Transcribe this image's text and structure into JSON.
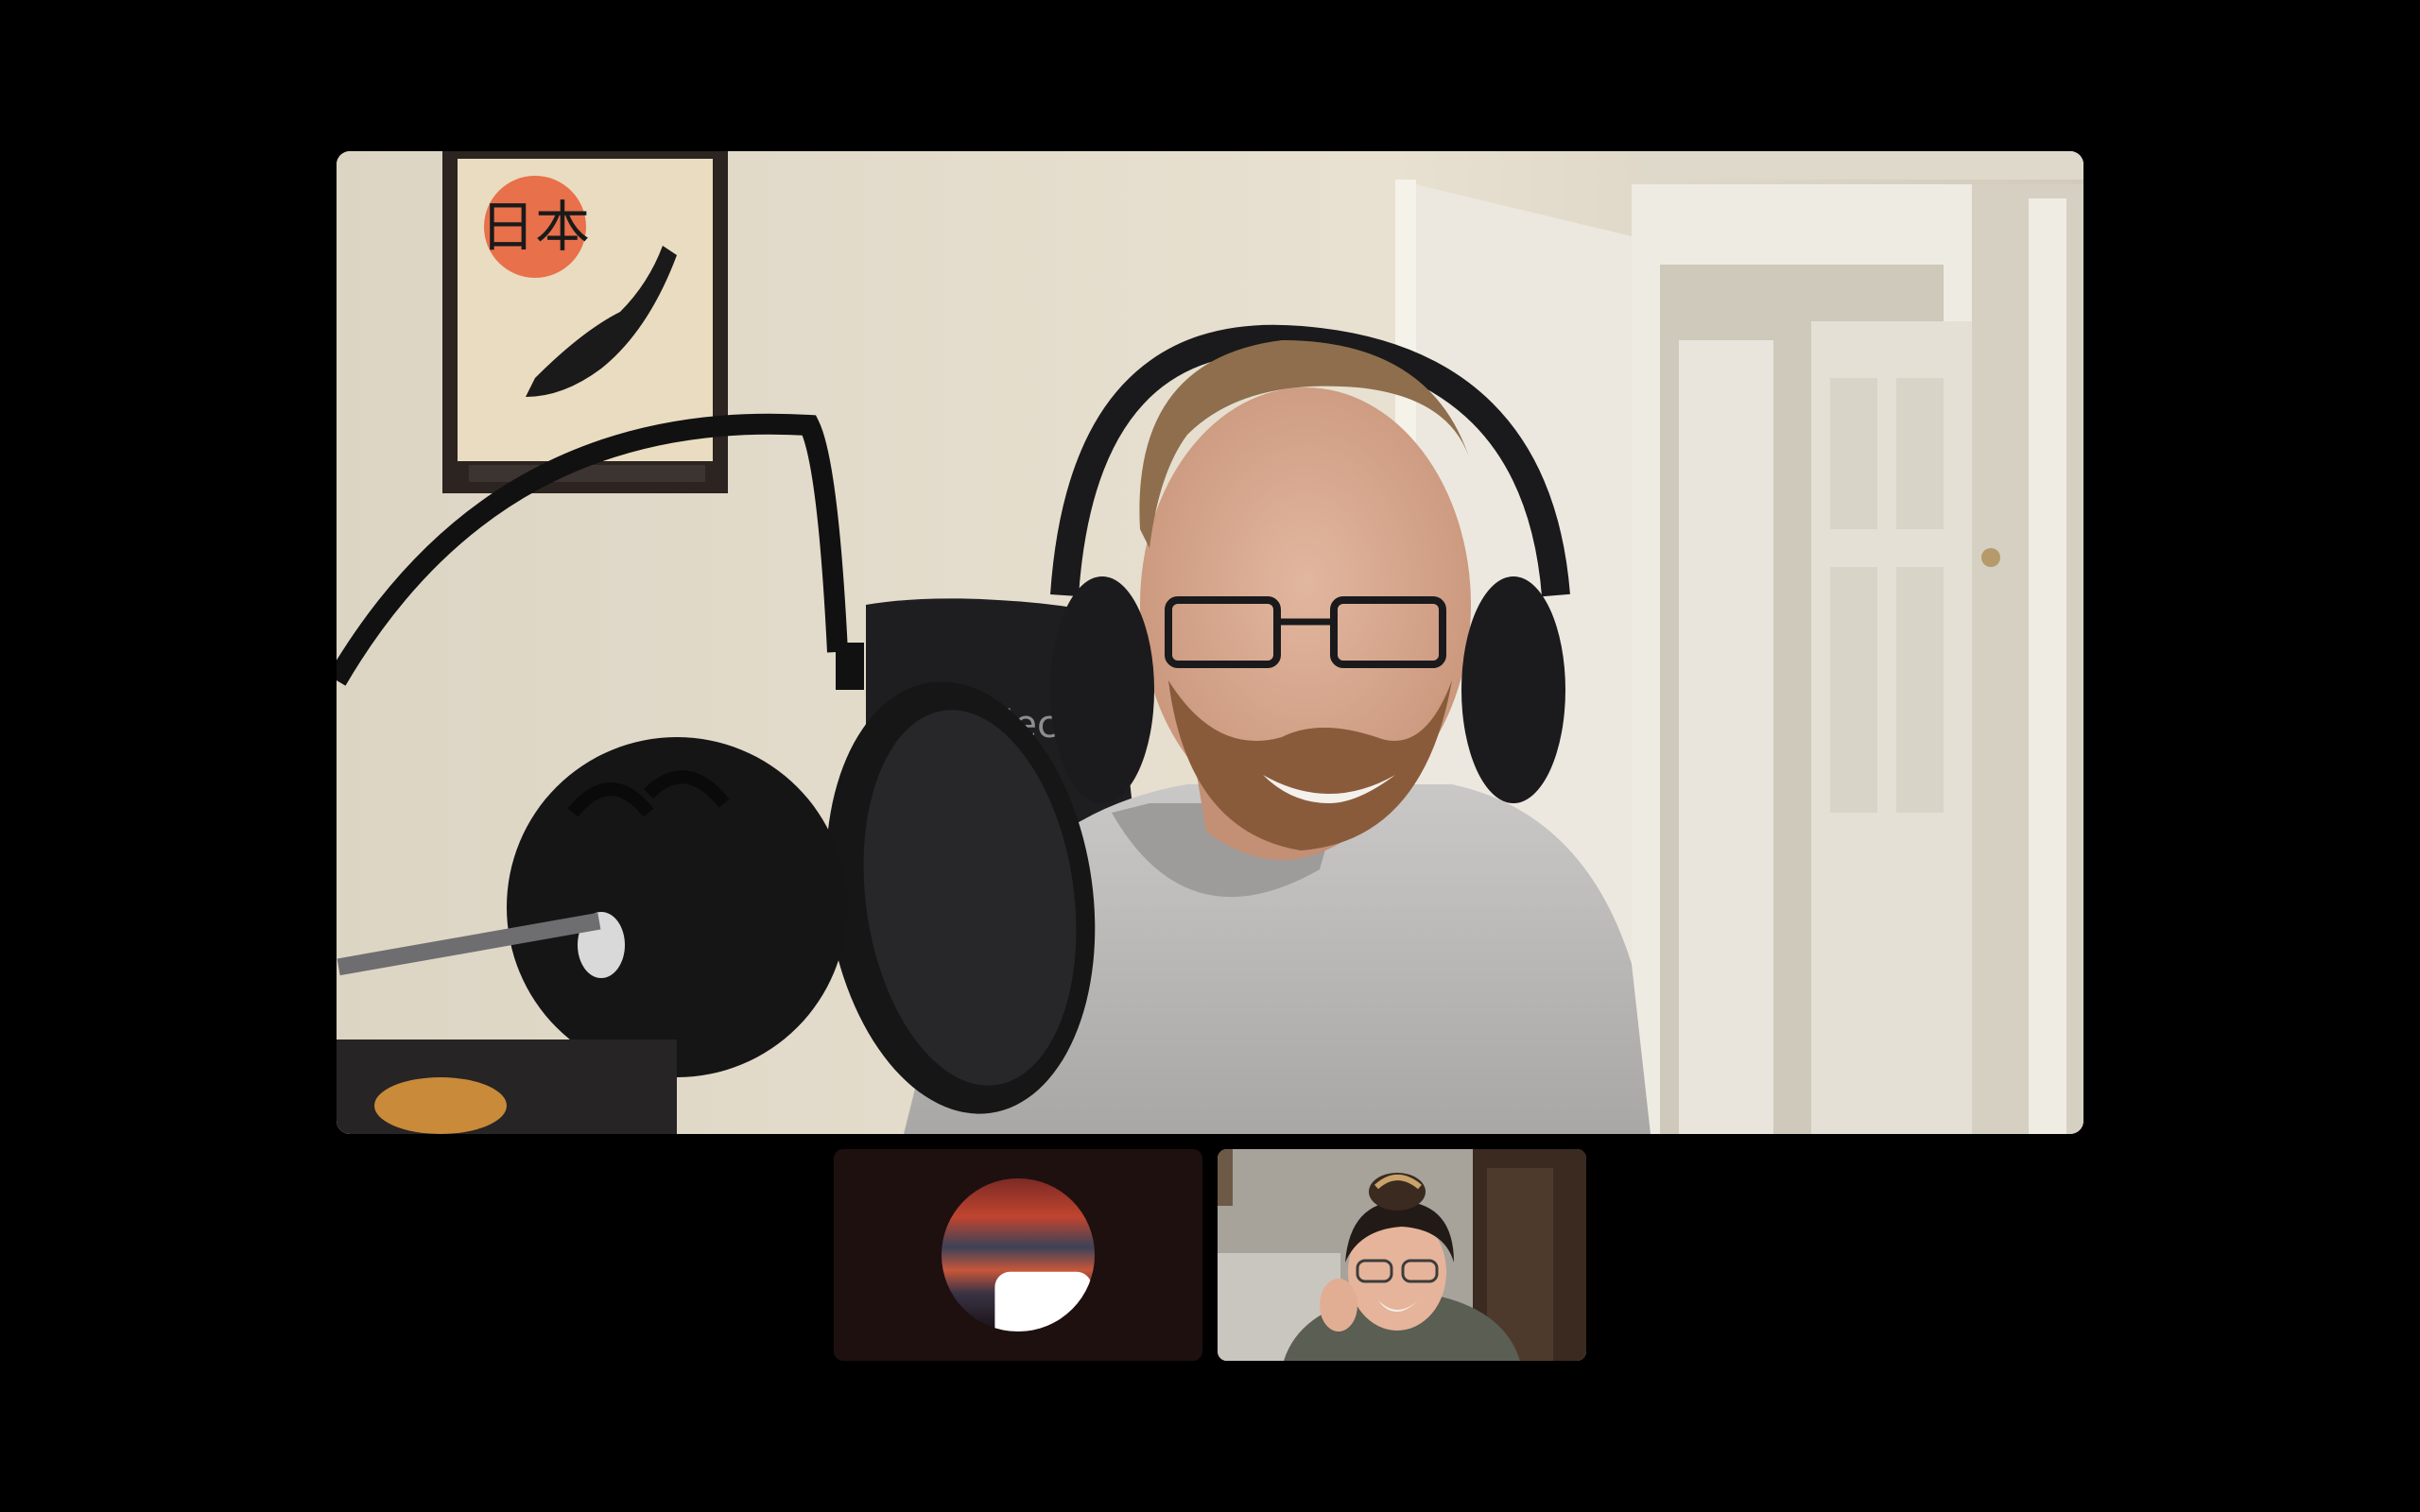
{
  "call": {
    "main_participant": {
      "role": "active-speaker",
      "poster_text": "日本",
      "chair_brand": "noblech"
    },
    "self_view": {
      "state": "camera-off",
      "icon": "video-camera-icon"
    },
    "remote_thumbnail": {
      "state": "camera-on"
    }
  },
  "colors": {
    "background": "#000000",
    "self_tile_bg": "#1f1010",
    "wall": "#e6dfd0",
    "door": "#f0ece2"
  }
}
